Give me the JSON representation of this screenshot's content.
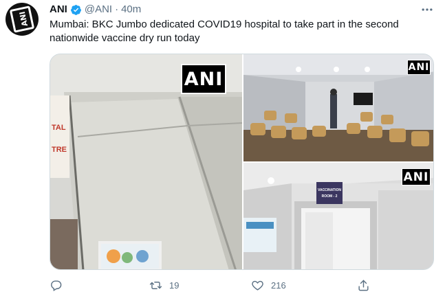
{
  "tweet": {
    "display_name": "ANI",
    "handle": "@ANI",
    "separator": "·",
    "time": "40m",
    "text": "Mumbai: BKC Jumbo dedicated COVID19 hospital to take part in the second nationwide vaccine dry run today",
    "verified": true
  },
  "media": {
    "watermark": "ANI",
    "left_photo": {
      "sign_partial_1": "TAL",
      "sign_partial_2": "TRE"
    },
    "bottom_photo": {
      "room_sign_line1": "VACCINATION",
      "room_sign_line2": "ROOM - 2"
    }
  },
  "actions": {
    "reply_count": "",
    "retweet_count": "19",
    "like_count": "216"
  },
  "colors": {
    "accent": "#1da1f2",
    "secondary_text": "#5b7083",
    "primary_text": "#0f1419"
  },
  "icons": [
    "more-icon",
    "verified-icon",
    "reply-icon",
    "retweet-icon",
    "like-icon",
    "share-icon"
  ]
}
